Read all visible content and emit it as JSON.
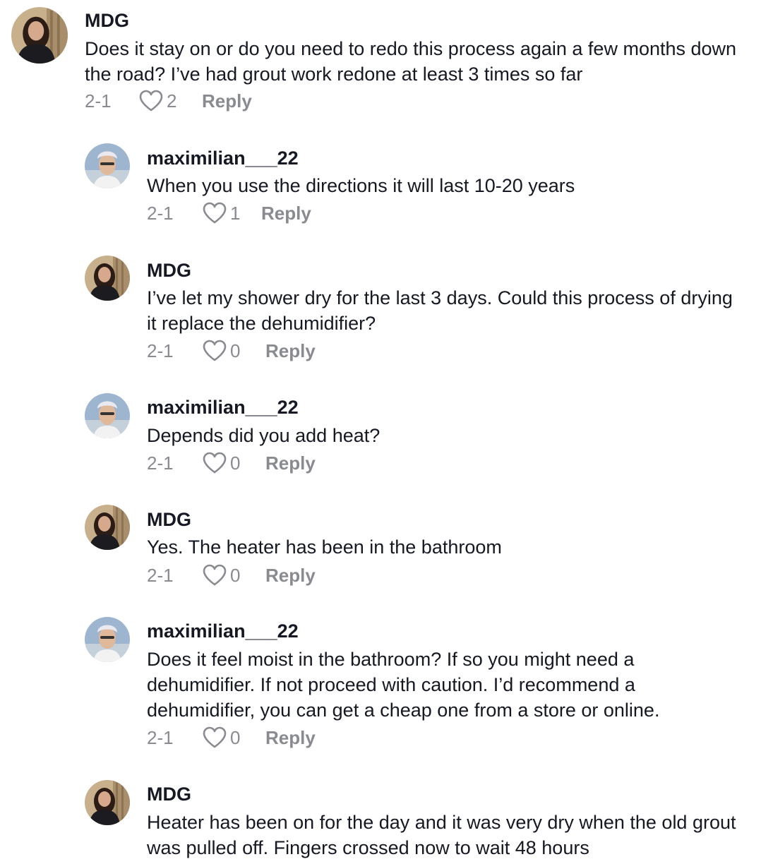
{
  "comments": [
    {
      "username": "MDG",
      "text": "Does it stay on or do you need to redo this process again a few months down the road? I’ve had grout work redone at least 3 times so far",
      "date": "2-1",
      "likes": "2",
      "reply": "Reply",
      "avatar": "woman-avatar"
    },
    {
      "username": "maximilian___22",
      "text": "When you use the directions it will last 10-20 years",
      "date": "2-1",
      "likes": "1",
      "reply": "Reply",
      "avatar": "man-cap-avatar"
    },
    {
      "username": "MDG",
      "text": "I’ve let my shower dry for the last 3 days. Could this process of drying it replace the dehumidifier?",
      "date": "2-1",
      "likes": "0",
      "reply": "Reply",
      "avatar": "woman-avatar"
    },
    {
      "username": "maximilian___22",
      "text": "Depends did you add heat?",
      "date": "2-1",
      "likes": "0",
      "reply": "Reply",
      "avatar": "man-cap-avatar"
    },
    {
      "username": "MDG",
      "text": "Yes. The heater has been in the bathroom",
      "date": "2-1",
      "likes": "0",
      "reply": "Reply",
      "avatar": "woman-avatar"
    },
    {
      "username": "maximilian___22",
      "text": "Does it feel moist in the bathroom? If so you might need a dehumidifier. If not proceed with caution. I’d recommend a dehumidifier, you can get a cheap one from a store or online.",
      "date": "2-1",
      "likes": "0",
      "reply": "Reply",
      "avatar": "man-cap-avatar"
    },
    {
      "username": "MDG",
      "text": "Heater has been on for the day and it was very dry when the old grout was pulled off. Fingers crossed now to wait 48 hours",
      "date": "",
      "likes": "",
      "reply": "",
      "avatar": "woman-avatar"
    }
  ]
}
